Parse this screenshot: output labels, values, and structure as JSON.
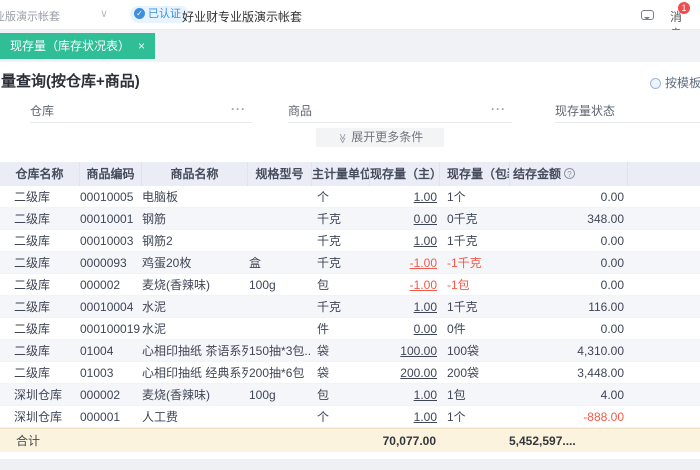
{
  "topbar": {
    "account": "业版演示帐套",
    "verified": "已认证",
    "company": "好业财专业版演示帐套",
    "messages": "消息",
    "message_count": "1"
  },
  "tab": {
    "title": "现存量（库存状况表）",
    "close": "×"
  },
  "page": {
    "title": "量查询(按仓库+商品)",
    "scheme": "按模板"
  },
  "filters": {
    "warehouse_label": "仓库",
    "product_label": "商品",
    "status_label": "现存量状态",
    "picker": "···"
  },
  "toolbar": {
    "expand_label": "展开更多条件"
  },
  "icons": {
    "verified_check": "✓",
    "chevron_down": "∨",
    "double_chevron": "≫",
    "help": "?"
  },
  "colors": {
    "tab_green": "#2FBE96",
    "negative_red": "#F15B4A",
    "verified_blue": "#3F8FDF",
    "header_bg": "#EBEDF6",
    "footer_bg": "#FBF3DD",
    "badge_red": "#F14C50"
  },
  "table": {
    "columns": [
      "仓库名称",
      "商品编码",
      "商品名称",
      "规格型号",
      "主计量单位",
      "现存量（主）",
      "现存量（包装）",
      "结存金额"
    ],
    "rows": [
      {
        "warehouse": "二级库",
        "code": "00010005",
        "name": "电脑板",
        "spec": "",
        "unit": "个",
        "qty": "1.00",
        "pkg": "1个",
        "amount": "0.00"
      },
      {
        "warehouse": "二级库",
        "code": "00010001",
        "name": "钢筋",
        "spec": "",
        "unit": "千克",
        "qty": "0.00",
        "pkg": "0千克",
        "amount": "348.00"
      },
      {
        "warehouse": "二级库",
        "code": "00010003",
        "name": "钢筋2",
        "spec": "",
        "unit": "千克",
        "qty": "1.00",
        "pkg": "1千克",
        "amount": "0.00"
      },
      {
        "warehouse": "二级库",
        "code": "0000093",
        "name": "鸡蛋20枚",
        "spec": "盒",
        "unit": "千克",
        "qty": "-1.00",
        "pkg": "-1千克",
        "amount": "0.00"
      },
      {
        "warehouse": "二级库",
        "code": "000002",
        "name": "麦烧(香辣味)",
        "spec": "100g",
        "unit": "包",
        "qty": "-1.00",
        "pkg": "-1包",
        "amount": "0.00"
      },
      {
        "warehouse": "二级库",
        "code": "00010004",
        "name": "水泥",
        "spec": "",
        "unit": "千克",
        "qty": "1.00",
        "pkg": "1千克",
        "amount": "116.00"
      },
      {
        "warehouse": "二级库",
        "code": "000100019",
        "name": "水泥",
        "spec": "",
        "unit": "件",
        "qty": "0.00",
        "pkg": "0件",
        "amount": "0.00"
      },
      {
        "warehouse": "二级库",
        "code": "01004",
        "name": "心相印抽纸 茶语系列 ...",
        "spec": "150抽*3包...",
        "unit": "袋",
        "qty": "100.00",
        "pkg": "100袋",
        "amount": "4,310.00"
      },
      {
        "warehouse": "二级库",
        "code": "01003",
        "name": "心相印抽纸 经典系列",
        "spec": "200抽*6包",
        "unit": "袋",
        "qty": "200.00",
        "pkg": "200袋",
        "amount": "3,448.00"
      },
      {
        "warehouse": "深圳仓库",
        "code": "000002",
        "name": "麦烧(香辣味)",
        "spec": "100g",
        "unit": "包",
        "qty": "1.00",
        "pkg": "1包",
        "amount": "4.00"
      },
      {
        "warehouse": "深圳仓库",
        "code": "000001",
        "name": "人工费",
        "spec": "",
        "unit": "个",
        "qty": "1.00",
        "pkg": "1个",
        "amount": "-888.00"
      }
    ],
    "footer": {
      "label": "合计",
      "qty_total": "70,077.00",
      "amount_total": "5,452,597...."
    }
  }
}
